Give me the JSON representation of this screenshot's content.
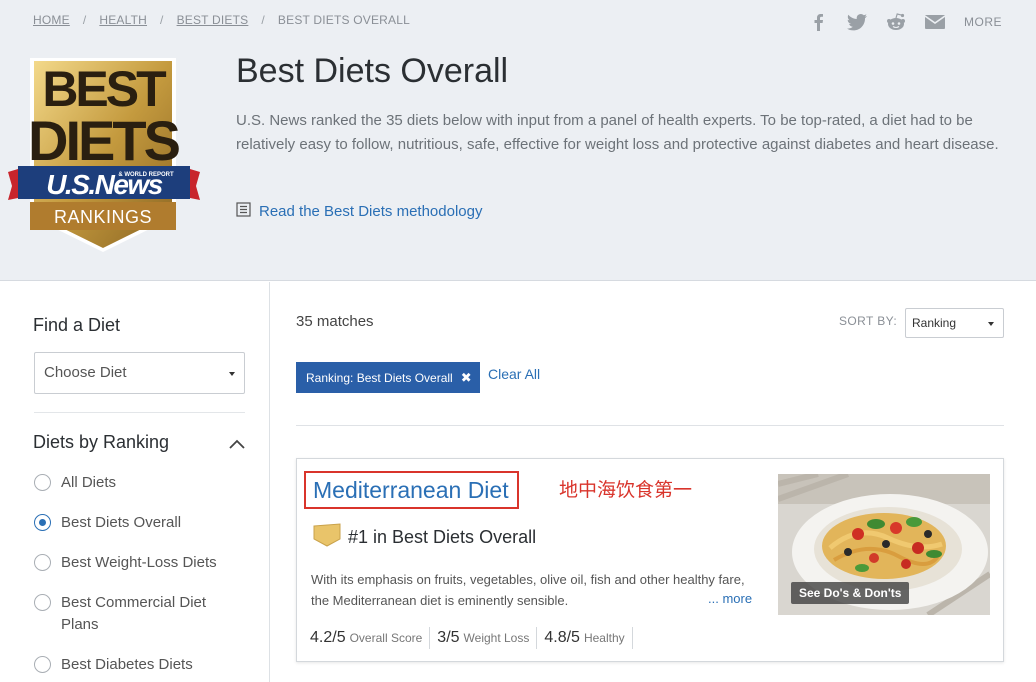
{
  "breadcrumb": {
    "items": [
      "HOME",
      "HEALTH",
      "BEST DIETS"
    ],
    "current": "BEST DIETS OVERALL",
    "separator": "/"
  },
  "share": {
    "icons": [
      "facebook-icon",
      "twitter-icon",
      "reddit-icon",
      "email-icon"
    ],
    "more_label": "MORE"
  },
  "badge": {
    "line1": "BEST",
    "line2": "DIETS",
    "brand": "U.S.News",
    "brand_sub": "& WORLD REPORT",
    "ribbon": "RANKINGS",
    "colors": {
      "gold": "#c9a24b",
      "navy": "#1d3e7c",
      "red": "#c8252c"
    }
  },
  "header": {
    "title": "Best Diets Overall",
    "intro": "U.S. News ranked the 35 diets below with input from a panel of health experts. To be top-rated, a diet had to be relatively easy to follow, nutritious, safe, effective for weight loss and protective against diabetes and heart disease.",
    "methodology_link": "Read the Best Diets methodology"
  },
  "sidebar": {
    "find_title": "Find a Diet",
    "choose_placeholder": "Choose Diet",
    "ranking_title": "Diets by Ranking",
    "ranking_options": [
      {
        "label": "All Diets",
        "selected": false
      },
      {
        "label": "Best Diets Overall",
        "selected": true
      },
      {
        "label": "Best Weight-Loss Diets",
        "selected": false
      },
      {
        "label": "Best Commercial Diet Plans",
        "selected": false
      },
      {
        "label": "Best Diabetes Diets",
        "selected": false
      }
    ]
  },
  "results": {
    "count": "35",
    "count_suffix": "matches",
    "sort_label": "SORT BY:",
    "sort_value": "Ranking",
    "filter_chip": "Ranking: Best Diets Overall",
    "clear_all": "Clear All"
  },
  "card": {
    "name": "Mediterranean Diet",
    "annotation": "地中海饮食第一",
    "rank_text": "#1 in Best Diets Overall",
    "description": "With its emphasis on fruits, vegetables, olive oil, fish and other healthy fare, the Mediterranean diet is eminently sensible.",
    "more_label": "... more",
    "photo_button": "See Do's & Don'ts",
    "scores": [
      {
        "value": "4.2/5",
        "label": "Overall Score"
      },
      {
        "value": "3/5",
        "label": "Weight Loss"
      },
      {
        "value": "4.8/5",
        "label": "Healthy"
      }
    ]
  },
  "colors": {
    "accent": "#2a6fb5",
    "chip_bg": "#2a5fa8",
    "annotation_red": "#d9342b",
    "header_bg": "#eceff3"
  }
}
